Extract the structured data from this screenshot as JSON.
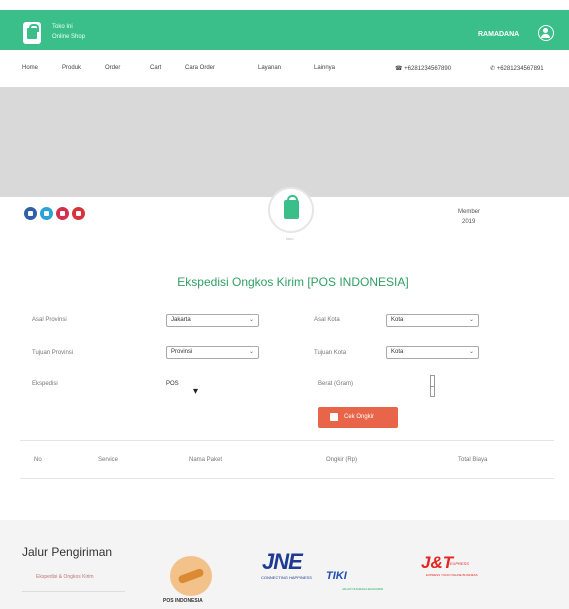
{
  "header": {
    "brand_line1": "Toko Ini",
    "brand_line2": "Online Shop",
    "user_name": "RAMADANA",
    "accent": "#3bbf8a"
  },
  "nav": {
    "items": [
      "Home",
      "Produk",
      "Order",
      "Cart",
      "Cara Order",
      "Layanan",
      "Lainnya"
    ],
    "phone": "☎ +6281234567890",
    "whatsapp": "✆ +6281234567891"
  },
  "social": {
    "icons": [
      "facebook-icon",
      "twitter-icon",
      "instagram-icon",
      "youtube-icon"
    ],
    "colors": [
      "#2e5fa8",
      "#2ba3d6",
      "#d1304f",
      "#d8333a"
    ]
  },
  "profile": {
    "caption": "toko",
    "since_line1": "Member",
    "since_line2": "2019"
  },
  "page": {
    "title": "Ekspedisi Ongkos Kirim [POS INDONESIA]"
  },
  "form": {
    "asal_label": "Asal Provinsi",
    "asal_value": "Jakarta",
    "asal_kota_label": "Asal Kota",
    "asal_kota_value": "Kota",
    "tujuan_prov_label": "Tujuan Provinsi",
    "tujuan_prov_value": "Provinsi",
    "tujuan_kota_label": "Tujuan Kota",
    "tujuan_kota_value": "Kota",
    "ekspedisi_label": "Ekspedisi",
    "ekspedisi_value": "POS",
    "berat_label": "Berat (Gram)",
    "search_label": "Cek Ongkir"
  },
  "results": {
    "columns": [
      "No",
      "Service",
      "Nama Paket",
      "Ongkir (Rp)",
      "Total Biaya"
    ]
  },
  "footer": {
    "title": "Jalur Pengiriman",
    "link": "Ekspedisi & Ongkos Kirim",
    "pos_label": "POS INDONESIA",
    "jne_label": "JNE",
    "jne_sub": "CONNECTING HAPPINESS",
    "tiki_label": "TIKI",
    "tiki_sub": "JALUR NUGRAHA EKAKURIR",
    "jt_label": "J&T",
    "jt_sub": "EXPRESS",
    "jt_sub2": "EXPRESS YOUR ONLINE BUSINESS"
  }
}
